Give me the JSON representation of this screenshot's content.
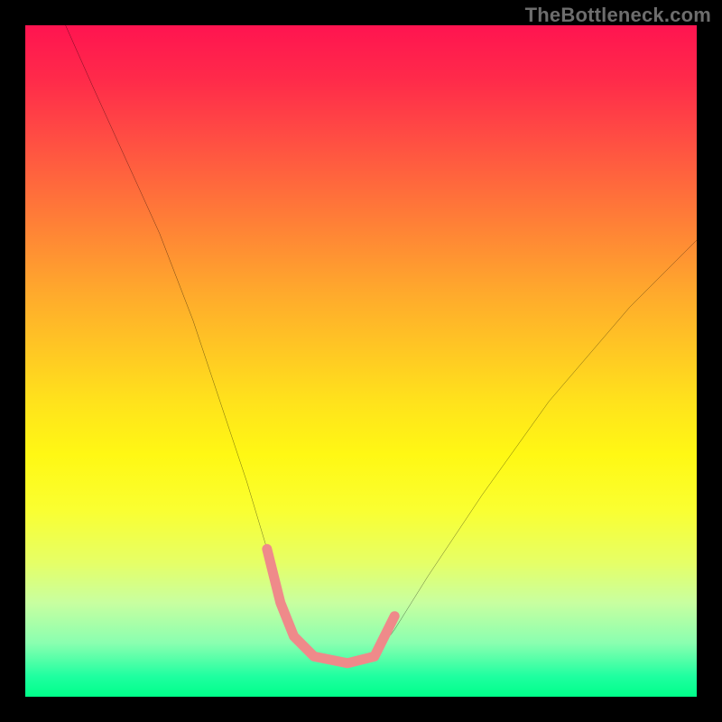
{
  "watermark": "TheBottleneck.com",
  "chart_data": {
    "type": "line",
    "title": "",
    "xlabel": "",
    "ylabel": "",
    "xlim": [
      0,
      100
    ],
    "ylim": [
      0,
      100
    ],
    "grid": false,
    "note": "Abstract bottleneck curve over vertical rainbow gradient; axes unlabeled; values are estimated pixel-relative positions on a 0–100 scale.",
    "series": [
      {
        "name": "bottleneck-curve",
        "stroke": "#000000",
        "stroke_width": 2,
        "x": [
          6,
          10,
          15,
          20,
          25,
          29,
          33,
          36,
          38,
          40,
          43,
          48,
          52,
          55,
          60,
          68,
          78,
          90,
          100
        ],
        "values": [
          100,
          91,
          80,
          69,
          56,
          44,
          32,
          22,
          14,
          9,
          6,
          5,
          6,
          10,
          18,
          30,
          44,
          58,
          68
        ]
      },
      {
        "name": "highlight-segment",
        "stroke": "#ef8a8a",
        "stroke_width": 11,
        "linecap": "round",
        "x": [
          36,
          38,
          40,
          43,
          48,
          52,
          55
        ],
        "values": [
          22,
          14,
          9,
          6,
          5,
          6,
          12
        ]
      }
    ],
    "gradient_stops": [
      {
        "pos": 0.0,
        "color": "#ff1450"
      },
      {
        "pos": 0.16,
        "color": "#ff4a44"
      },
      {
        "pos": 0.32,
        "color": "#ff8a34"
      },
      {
        "pos": 0.48,
        "color": "#ffc624"
      },
      {
        "pos": 0.64,
        "color": "#fff814"
      },
      {
        "pos": 0.8,
        "color": "#e6ff66"
      },
      {
        "pos": 0.92,
        "color": "#8affb0"
      },
      {
        "pos": 1.0,
        "color": "#00ff8a"
      }
    ]
  }
}
